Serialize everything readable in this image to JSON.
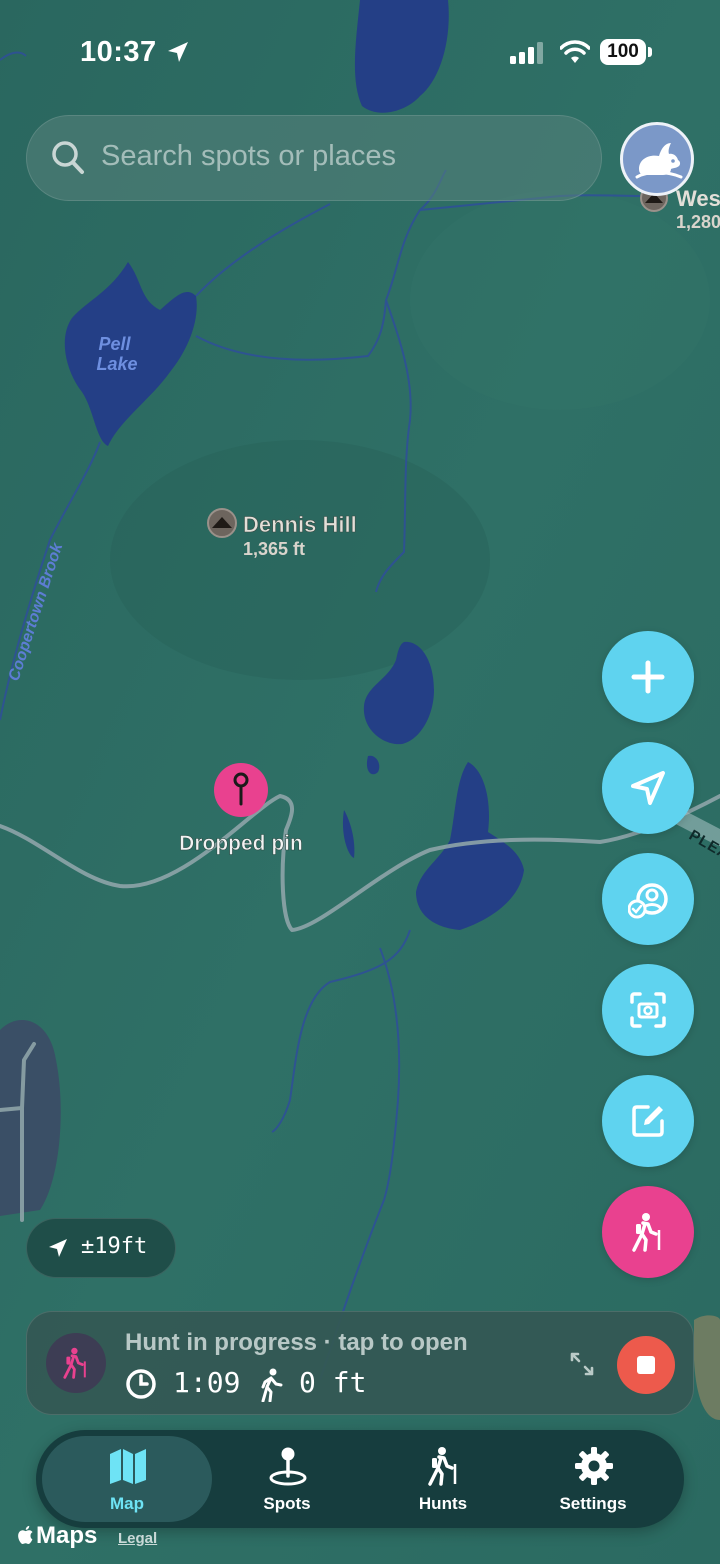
{
  "status_bar": {
    "time": "10:37",
    "battery": "100"
  },
  "search": {
    "placeholder": "Search spots or places"
  },
  "map": {
    "labels": {
      "lake": [
        "Pell",
        "Lake"
      ],
      "brook": "Coopertown Brook",
      "peak_name": "Dennis Hill",
      "peak_elev": "1,365 ft",
      "peak2_name": "Wes",
      "peak2_elev": "1,280",
      "road": "PLEA"
    },
    "pin_label": "Dropped pin"
  },
  "actions": [
    {
      "name": "add",
      "icon": "plus-icon"
    },
    {
      "name": "locate",
      "icon": "location-arrow-icon"
    },
    {
      "name": "check-people",
      "icon": "user-check-icon"
    },
    {
      "name": "scan",
      "icon": "camera-scan-icon"
    },
    {
      "name": "note",
      "icon": "edit-icon"
    },
    {
      "name": "hunt",
      "icon": "hiker-icon"
    }
  ],
  "accuracy": {
    "text": "±19ft"
  },
  "hunt": {
    "title": "Hunt in progress · tap to open",
    "elapsed": "1:09",
    "distance": "0 ft"
  },
  "tabs": [
    {
      "label": "Map",
      "icon": "map-icon",
      "active": true
    },
    {
      "label": "Spots",
      "icon": "pin-icon",
      "active": false
    },
    {
      "label": "Hunts",
      "icon": "hiker-icon",
      "active": false
    },
    {
      "label": "Settings",
      "icon": "gear-icon",
      "active": false
    }
  ],
  "attribution": {
    "maps": "Maps",
    "legal": "Legal"
  },
  "colors": {
    "accent": "#5fd3ef",
    "pink": "#e9418f",
    "stop": "#ed5a4c",
    "tab_active": "#6ee3f5",
    "water": "#243f86",
    "map_bg": "#2c6b62"
  }
}
